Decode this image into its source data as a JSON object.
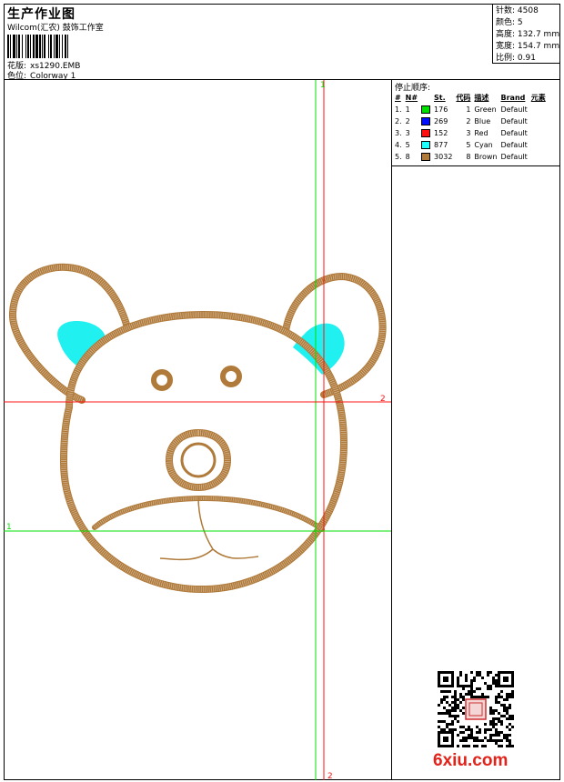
{
  "header": {
    "title": "生产作业图",
    "subtitle": "Wilcom(汇农) 鼓饰工作室",
    "pattern_label": "花版:",
    "pattern_value": "xs1290.EMB",
    "color_label": "色位:",
    "color_value": "Colorway 1"
  },
  "stats": {
    "stitches_label": "针数:",
    "stitches_value": "4508",
    "colors_label": "颜色:",
    "colors_value": "5",
    "height_label": "高度:",
    "height_value": "132.7 mm",
    "width_label": "宽度:",
    "width_value": "154.7 mm",
    "scale_label": "比例:",
    "scale_value": "0.91"
  },
  "stop_sequence": {
    "title": "停止顺序:",
    "columns": [
      "#",
      "N#",
      "St.",
      "代码",
      "描述",
      "Brand",
      "元素"
    ],
    "rows": [
      {
        "idx": "1.",
        "n": "1",
        "color": "#00e000",
        "st": "176",
        "code": "1",
        "desc": "Green",
        "brand": "Default"
      },
      {
        "idx": "2.",
        "n": "2",
        "color": "#0010ff",
        "st": "269",
        "code": "2",
        "desc": "Blue",
        "brand": "Default"
      },
      {
        "idx": "3.",
        "n": "3",
        "color": "#ff1010",
        "st": "152",
        "code": "3",
        "desc": "Red",
        "brand": "Default"
      },
      {
        "idx": "4.",
        "n": "5",
        "color": "#20ffff",
        "st": "877",
        "code": "5",
        "desc": "Cyan",
        "brand": "Default"
      },
      {
        "idx": "5.",
        "n": "8",
        "color": "#b07a3a",
        "st": "3032",
        "code": "8",
        "desc": "Brown",
        "brand": "Default"
      }
    ]
  },
  "guides": {
    "v1_label": "1",
    "h2_label": "2",
    "h1_label": "1",
    "v2_label": "2"
  },
  "palette": {
    "brown": "#b07a3a",
    "cyan": "#20f0f0",
    "green": "#00e000",
    "red": "#ff1010"
  },
  "watermark": {
    "site": "6xiu.com"
  }
}
